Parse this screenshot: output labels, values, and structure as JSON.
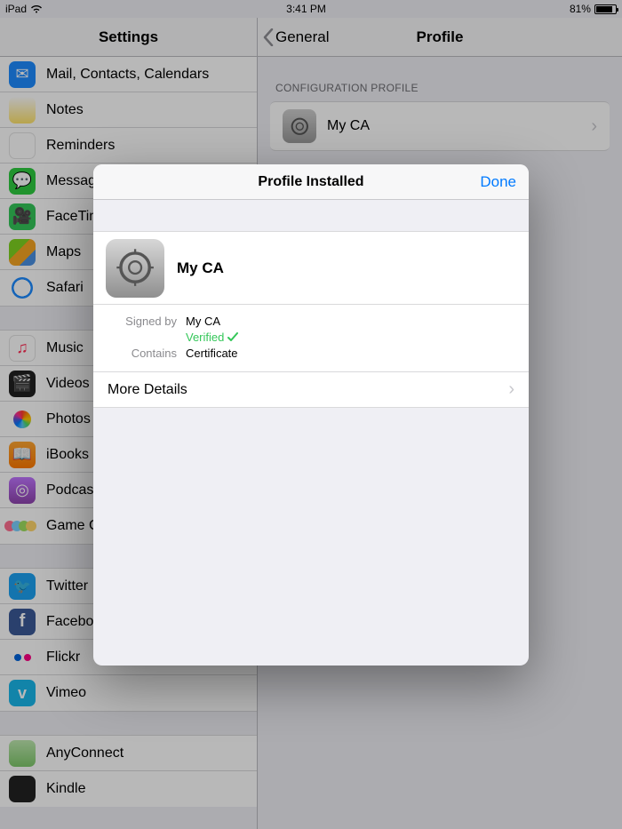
{
  "status": {
    "device": "iPad",
    "time": "3:41 PM",
    "battery": "81%"
  },
  "left": {
    "title": "Settings",
    "groups": [
      [
        {
          "label": "Mail, Contacts, Calendars",
          "icon": "mail-icon",
          "cls": "bg-blue",
          "glyph": "✉︎"
        },
        {
          "label": "Notes",
          "icon": "notes-icon",
          "cls": "bg-yellow",
          "glyph": ""
        },
        {
          "label": "Reminders",
          "icon": "reminders-icon",
          "cls": "bg-white",
          "glyph": ""
        },
        {
          "label": "Messages",
          "icon": "messages-icon",
          "cls": "bg-green",
          "glyph": "💬"
        },
        {
          "label": "FaceTime",
          "icon": "facetime-icon",
          "cls": "bg-grn2",
          "glyph": "🎥"
        },
        {
          "label": "Maps",
          "icon": "maps-icon",
          "cls": "bg-maps",
          "glyph": ""
        },
        {
          "label": "Safari",
          "icon": "safari-icon",
          "cls": "bg-safari",
          "glyph": "safari"
        }
      ],
      [
        {
          "label": "Music",
          "icon": "music-icon",
          "cls": "bg-white",
          "glyph": "music"
        },
        {
          "label": "Videos",
          "icon": "videos-icon",
          "cls": "bg-video",
          "glyph": "🎬"
        },
        {
          "label": "Photos & Camera",
          "icon": "photos-icon",
          "cls": "bg-photos",
          "glyph": "photos"
        },
        {
          "label": "iBooks",
          "icon": "ibooks-icon",
          "cls": "bg-orange",
          "glyph": "📖"
        },
        {
          "label": "Podcasts",
          "icon": "podcasts-icon",
          "cls": "bg-purple",
          "glyph": "◎"
        },
        {
          "label": "Game Center",
          "icon": "gamecenter-icon",
          "cls": "bg-bubbles",
          "glyph": "gc"
        }
      ],
      [
        {
          "label": "Twitter",
          "icon": "twitter-icon",
          "cls": "bg-tw",
          "glyph": "t"
        },
        {
          "label": "Facebook",
          "icon": "facebook-icon",
          "cls": "bg-fb",
          "glyph": "f"
        },
        {
          "label": "Flickr",
          "icon": "flickr-icon",
          "cls": "bg-flk",
          "glyph": "flickr"
        },
        {
          "label": "Vimeo",
          "icon": "vimeo-icon",
          "cls": "bg-vim",
          "glyph": "v"
        }
      ],
      [
        {
          "label": "AnyConnect",
          "icon": "anyconnect-icon",
          "cls": "bg-any",
          "glyph": ""
        },
        {
          "label": "Kindle",
          "icon": "kindle-icon",
          "cls": "bg-kin",
          "glyph": ""
        }
      ]
    ]
  },
  "right": {
    "back": "General",
    "title": "Profile",
    "section": "CONFIGURATION PROFILE",
    "profile_name": "My CA"
  },
  "modal": {
    "title": "Profile Installed",
    "done": "Done",
    "profile_name": "My CA",
    "signed_by_label": "Signed by",
    "signed_by_value": "My CA",
    "verified": "Verified",
    "contains_label": "Contains",
    "contains_value": "Certificate",
    "more": "More Details"
  }
}
